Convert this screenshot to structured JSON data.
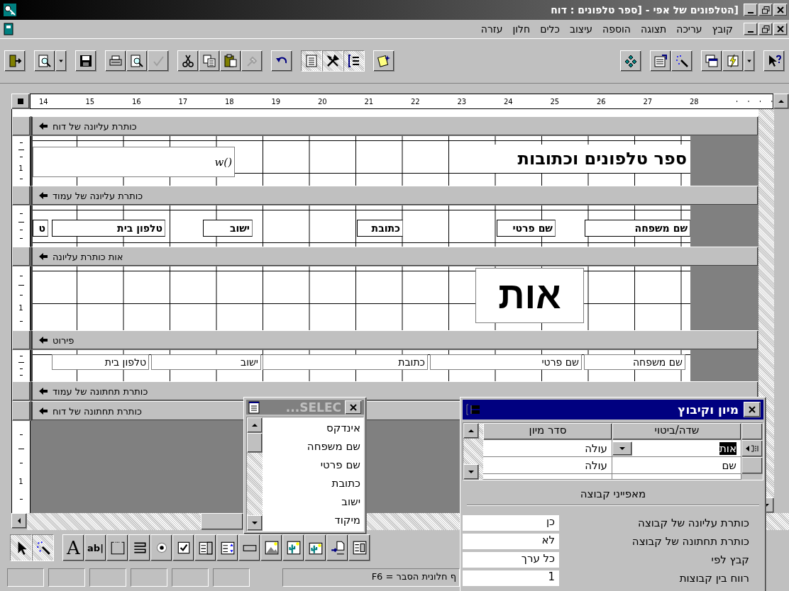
{
  "window": {
    "title": "[הטלפונים של אפי - [ספר טלפונים : דוח"
  },
  "menu": {
    "items": [
      "קובץ",
      "עריכה",
      "תצוגה",
      "הוספה",
      "עיצוב",
      "כלים",
      "חלון",
      "עזרה"
    ]
  },
  "toolbar": {
    "left": [
      [
        {
          "kind": "exit",
          "pressed": false,
          "disabled": false
        }
      ],
      [
        {
          "kind": "preview",
          "pressed": false,
          "disabled": false
        },
        {
          "kind": "dropdown",
          "pressed": false,
          "disabled": false
        }
      ],
      [
        {
          "kind": "save",
          "pressed": false,
          "disabled": false
        }
      ],
      [
        {
          "kind": "print",
          "pressed": false,
          "disabled": false
        },
        {
          "kind": "preview",
          "pressed": false,
          "disabled": false
        },
        {
          "kind": "spelling",
          "pressed": false,
          "disabled": true
        }
      ],
      [
        {
          "kind": "cut",
          "pressed": false,
          "disabled": false
        },
        {
          "kind": "copy",
          "pressed": false,
          "disabled": false
        },
        {
          "kind": "paste",
          "pressed": false,
          "disabled": false
        },
        {
          "kind": "painter",
          "pressed": false,
          "disabled": true
        }
      ],
      [
        {
          "kind": "undo",
          "pressed": false,
          "disabled": false
        }
      ],
      [
        {
          "kind": "sorting",
          "pressed": true,
          "disabled": false
        },
        {
          "kind": "toolbox",
          "pressed": true,
          "disabled": false
        },
        {
          "kind": "fieldlist",
          "pressed": true,
          "disabled": false
        }
      ],
      [
        {
          "kind": "build",
          "pressed": false,
          "disabled": false
        }
      ]
    ],
    "right": [
      [
        {
          "kind": "code",
          "pressed": false,
          "disabled": false
        }
      ],
      [
        {
          "kind": "properties",
          "pressed": false,
          "disabled": false
        },
        {
          "kind": "wand",
          "pressed": false,
          "disabled": false
        }
      ],
      [
        {
          "kind": "dbwindow",
          "pressed": false,
          "disabled": false
        },
        {
          "kind": "newobject",
          "pressed": false,
          "disabled": false
        },
        {
          "kind": "dropdown",
          "pressed": false,
          "disabled": false
        }
      ],
      [
        {
          "kind": "help",
          "pressed": false,
          "disabled": false
        }
      ]
    ]
  },
  "ruler": {
    "numbers": [
      "28",
      "27",
      "26",
      "25",
      "24",
      "23",
      "22",
      "21",
      "20",
      "19",
      "18",
      "17",
      "16",
      "15",
      "14"
    ]
  },
  "design": {
    "sections": [
      {
        "kind": "report-header",
        "title": "כותרת עליונה של דוח",
        "ruler_mark": "1",
        "controls": [
          {
            "kind": "title",
            "text": "ספר טלפונים וכתובות"
          },
          {
            "kind": "textbox",
            "text": "w()"
          }
        ]
      },
      {
        "kind": "page-header",
        "title": "כותרת עליונה של עמוד",
        "controls": [
          {
            "kind": "label",
            "text": "שם משפחה"
          },
          {
            "kind": "label",
            "text": "שם פרטי"
          },
          {
            "kind": "label",
            "text": "כתובת"
          },
          {
            "kind": "label",
            "text": "ישוב"
          },
          {
            "kind": "label",
            "text": "טלפון בית"
          },
          {
            "kind": "label",
            "text": "ט"
          }
        ]
      },
      {
        "kind": "group-header",
        "title": "אות כותרת עליונה",
        "ruler_mark": "1",
        "controls": [
          {
            "kind": "big-label",
            "text": "אות"
          }
        ]
      },
      {
        "kind": "detail",
        "title": "פירוט",
        "controls": [
          {
            "kind": "field",
            "text": "שם משפחה"
          },
          {
            "kind": "field",
            "text": "שם פרטי"
          },
          {
            "kind": "field",
            "text": "כתובת"
          },
          {
            "kind": "field",
            "text": "ישוב"
          },
          {
            "kind": "field",
            "text": "טלפון בית"
          }
        ]
      },
      {
        "kind": "page-footer",
        "title": "כותרת תחתונה של עמוד"
      },
      {
        "kind": "report-footer",
        "title": "כותרת תחתונה של דוח"
      }
    ],
    "empty_area_ruler_mark": "1"
  },
  "field_list": {
    "title": "SELEC...",
    "items": [
      "אינדקס",
      "שם משפחה",
      "שם פרטי",
      "כתובת",
      "ישוב",
      "מיקוד"
    ]
  },
  "sorting": {
    "title": "מיון וקיבוץ",
    "columns": [
      "שדה/ביטוי",
      "סדר מיון"
    ],
    "rows": [
      {
        "field": "אות",
        "order": "עולה",
        "selected": true
      },
      {
        "field": "שם",
        "order": "עולה",
        "selected": false
      }
    ],
    "properties_title": "מאפייני קבוצה",
    "properties": [
      {
        "label": "כותרת עליונה של קבוצה",
        "value": "כן"
      },
      {
        "label": "כותרת תחתונה של קבוצה",
        "value": "לא"
      },
      {
        "label": "קבץ לפי",
        "value": "כל ערך"
      },
      {
        "label": "רווח בין קבוצות",
        "value": "1"
      }
    ]
  },
  "toolbox": {
    "tools": [
      {
        "kind": "subform",
        "pressed": false
      },
      {
        "kind": "pagebreak",
        "pressed": false
      },
      {
        "kind": "bound",
        "pressed": false
      },
      {
        "kind": "unbound",
        "pressed": false
      },
      {
        "kind": "image",
        "pressed": false
      },
      {
        "kind": "command",
        "pressed": false
      },
      {
        "kind": "list",
        "pressed": false
      },
      {
        "kind": "combo",
        "pressed": false
      },
      {
        "kind": "checkbox",
        "pressed": false
      },
      {
        "kind": "option",
        "pressed": false
      },
      {
        "kind": "toggle",
        "pressed": false
      },
      {
        "kind": "option-group",
        "pressed": false
      },
      {
        "kind": "textbox",
        "glyph": "ab|",
        "pressed": false
      },
      {
        "kind": "label",
        "glyph": "A",
        "pressed": false
      },
      {
        "kind": "wizard",
        "pressed": true
      },
      {
        "kind": "pointer",
        "pressed": true
      }
    ]
  },
  "status_bar": {
    "text": "ף חלונית הסבר = F6"
  }
}
